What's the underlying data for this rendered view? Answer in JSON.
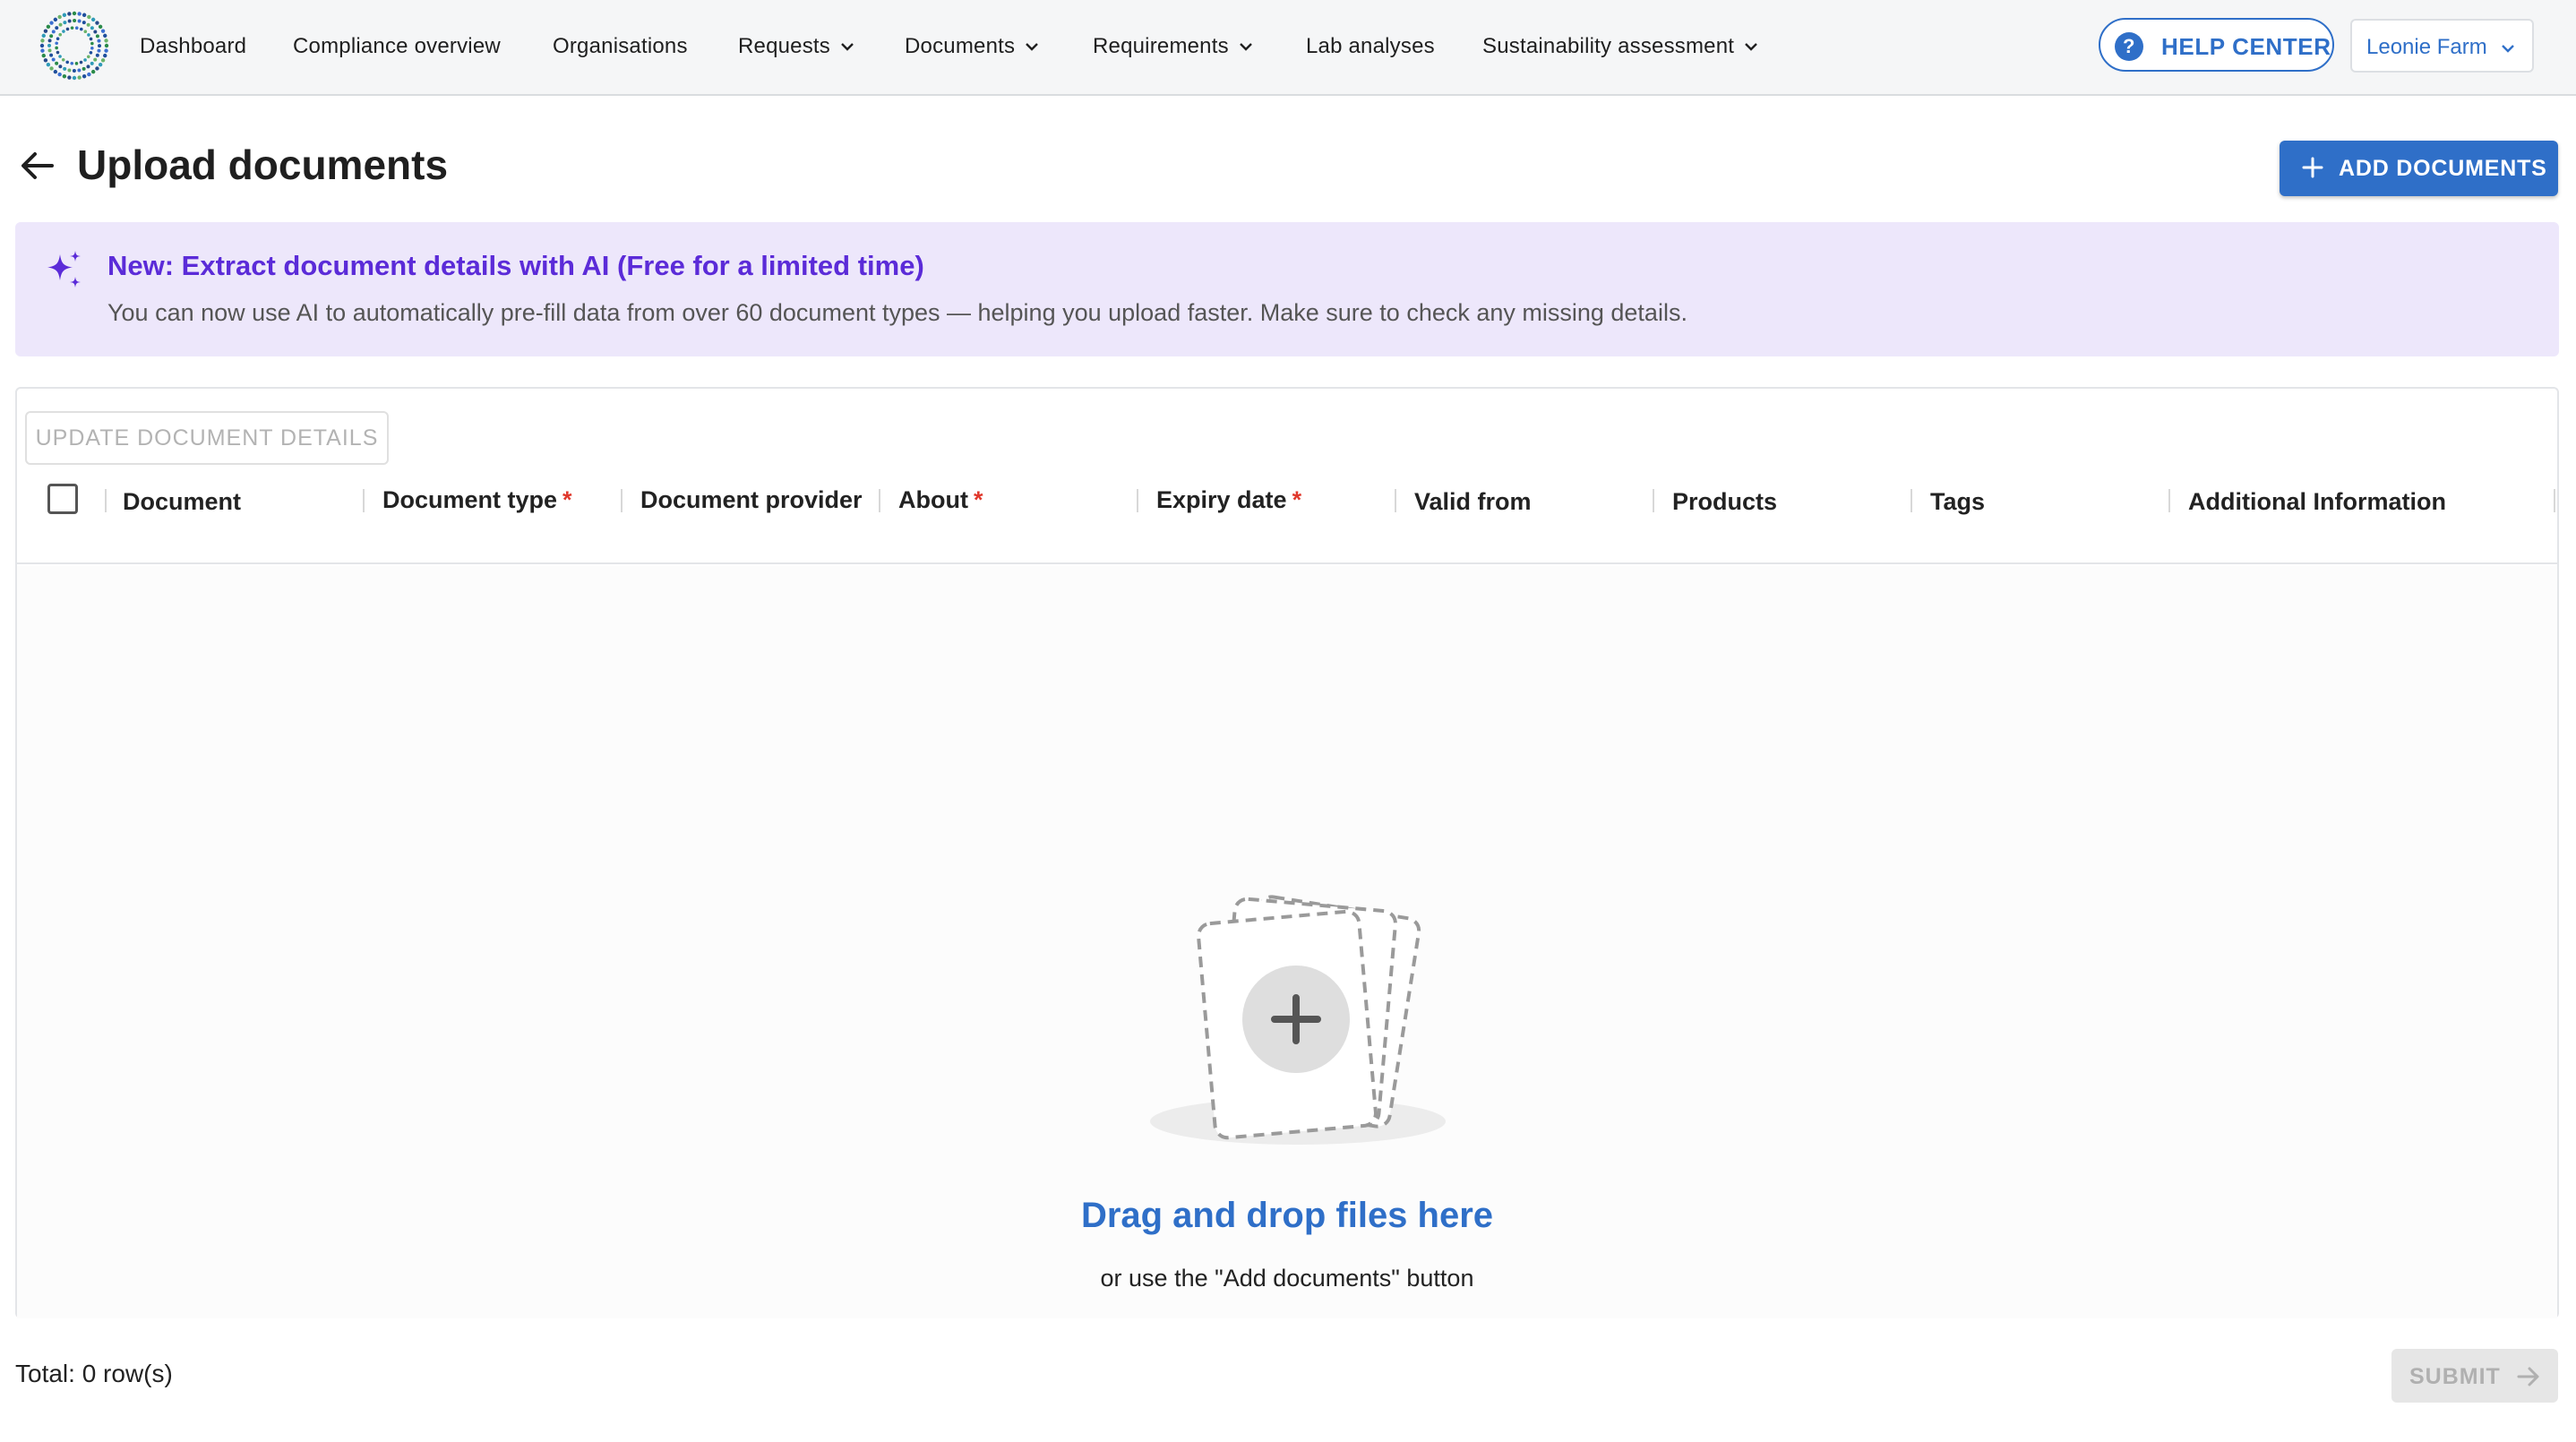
{
  "nav": {
    "items": [
      {
        "label": "Dashboard",
        "has_dropdown": false
      },
      {
        "label": "Compliance overview",
        "has_dropdown": false
      },
      {
        "label": "Organisations",
        "has_dropdown": false
      },
      {
        "label": "Requests",
        "has_dropdown": true
      },
      {
        "label": "Documents",
        "has_dropdown": true
      },
      {
        "label": "Requirements",
        "has_dropdown": true
      },
      {
        "label": "Lab analyses",
        "has_dropdown": false
      },
      {
        "label": "Sustainability assessment",
        "has_dropdown": true
      }
    ],
    "help_center": "HELP CENTER",
    "organisation": "Leonie Farm"
  },
  "page": {
    "title": "Upload documents",
    "add_button": "ADD DOCUMENTS"
  },
  "banner": {
    "title": "New: Extract document details with AI (Free for a limited time)",
    "description": "You can now use AI to automatically pre-fill data from over 60 document types — helping you upload faster. Make sure to check any missing details."
  },
  "grid": {
    "update_button": "UPDATE DOCUMENT DETAILS",
    "columns": [
      {
        "label": "Document",
        "required": false
      },
      {
        "label": "Document type",
        "required": true
      },
      {
        "label": "Document provider",
        "required": false
      },
      {
        "label": "About",
        "required": true
      },
      {
        "label": "Expiry date",
        "required": true
      },
      {
        "label": "Valid from",
        "required": false
      },
      {
        "label": "Products",
        "required": false
      },
      {
        "label": "Tags",
        "required": false
      },
      {
        "label": "Additional Information",
        "required": false
      }
    ],
    "required_marker": "*",
    "empty_title": "Drag and drop files here",
    "empty_subtitle": "or use the \"Add documents\" button"
  },
  "footer": {
    "total": "Total: 0 row(s)",
    "submit": "SUBMIT"
  },
  "colors": {
    "primary": "#2f6fc8",
    "ai_purple": "#5b2bd8",
    "banner_bg": "#ede7fb",
    "required": "#e0382c",
    "disabled_text": "#b3b3b3"
  },
  "icons": {
    "logo": "dotted-ring-logo",
    "back": "arrow-left-icon",
    "help": "question-circle-icon",
    "add": "plus-icon",
    "ai": "sparkle-icon",
    "submit": "arrow-right-icon"
  }
}
